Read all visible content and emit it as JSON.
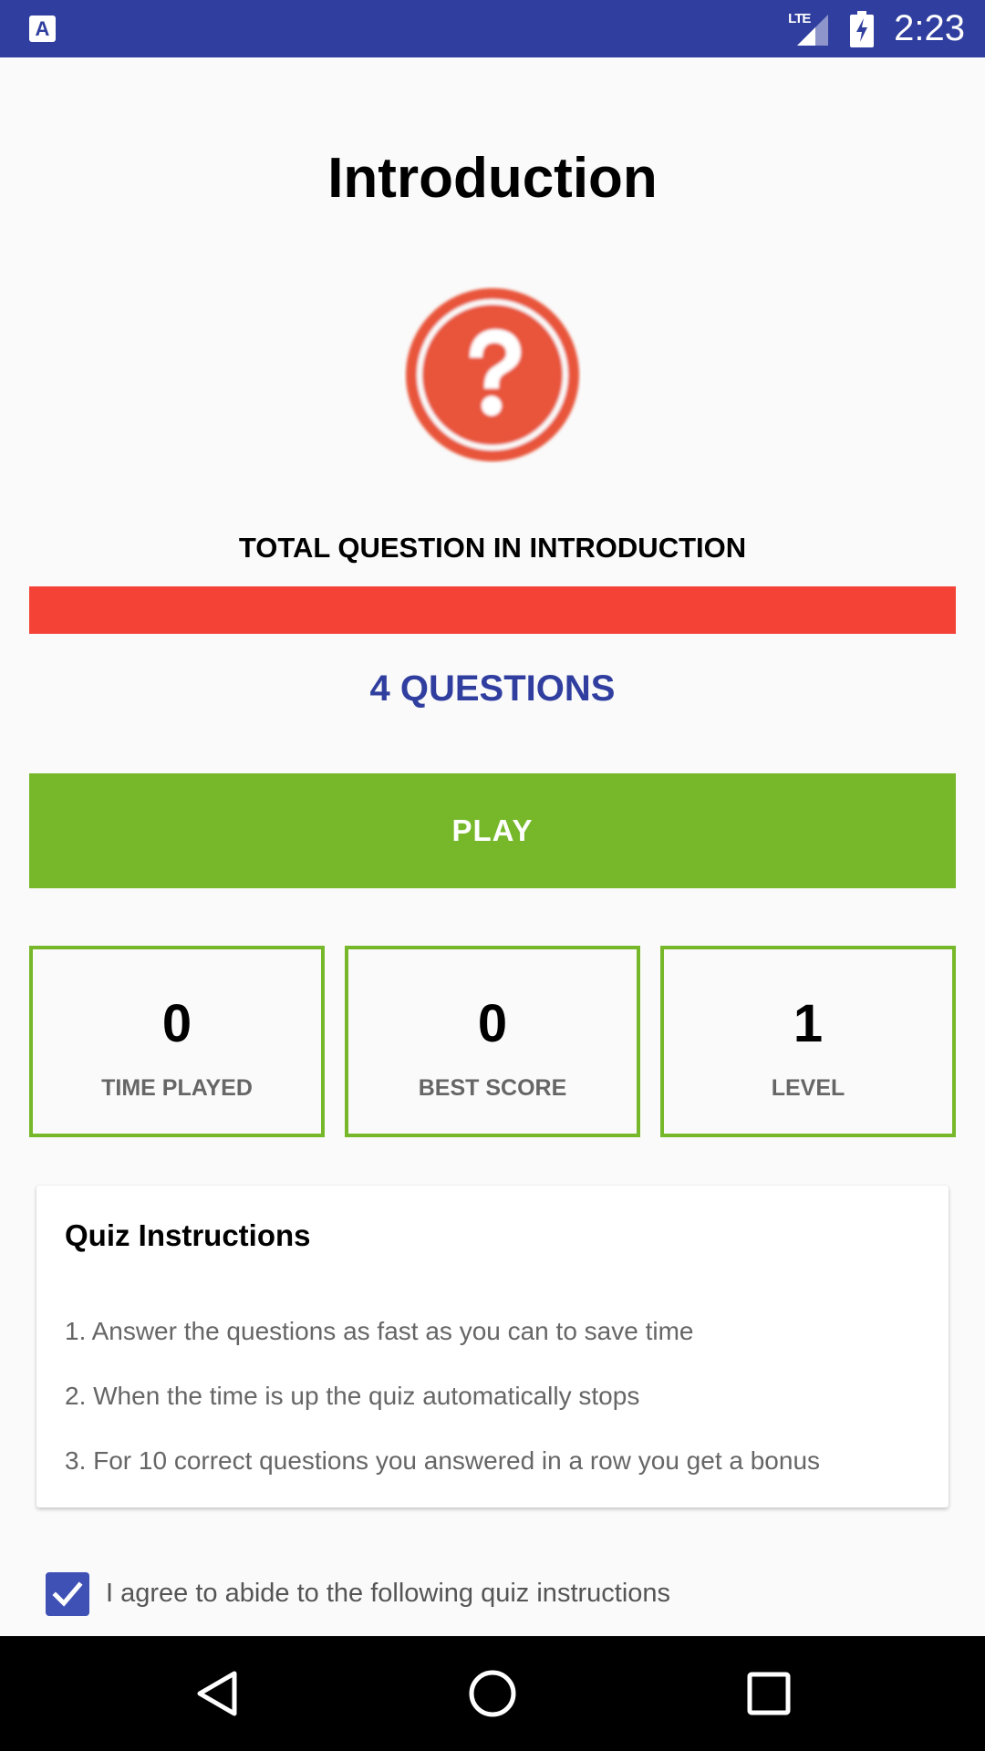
{
  "status_bar": {
    "network_label": "LTE",
    "time": "2:23",
    "app_icon_letter": "A",
    "color": "#303f9f"
  },
  "header": {
    "title": "Introduction"
  },
  "hero_icon": "question-circle-icon",
  "summary": {
    "label": "TOTAL QUESTION IN INTRODUCTION",
    "questions_count": "4 QUESTIONS",
    "bar_color": "#f44336",
    "count_color": "#303f9f"
  },
  "actions": {
    "play_label": "PLAY",
    "play_color": "#76b82a"
  },
  "stats": [
    {
      "value": "0",
      "label": "TIME PLAYED"
    },
    {
      "value": "0",
      "label": "BEST SCORE"
    },
    {
      "value": "1",
      "label": "LEVEL"
    }
  ],
  "instructions": {
    "title": "Quiz Instructions",
    "items": [
      "1. Answer the questions as fast as you can to save time",
      "2. When the time is up the quiz automatically stops",
      "3. For 10 correct questions you answered in a row you get a bonus"
    ]
  },
  "agreement": {
    "label": "I agree to abide to the following quiz instructions",
    "checked": true,
    "checkbox_color": "#3f51b5"
  },
  "nav_bar": {
    "icons": [
      "back-icon",
      "home-icon",
      "recents-icon"
    ]
  }
}
